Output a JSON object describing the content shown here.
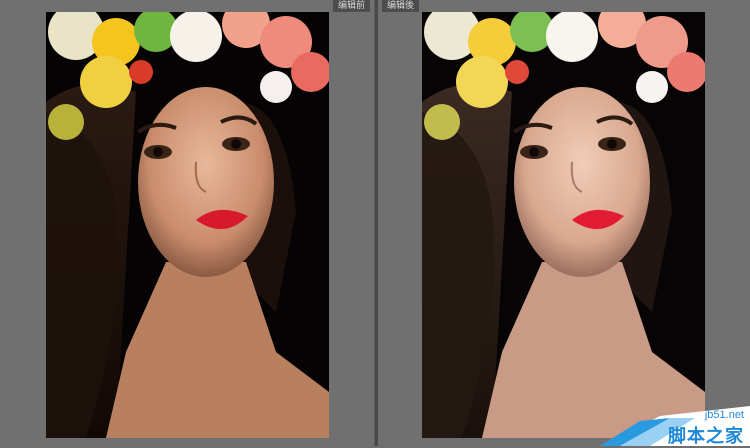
{
  "panels": {
    "before": {
      "label": "编辑前"
    },
    "after": {
      "label": "编辑後"
    }
  },
  "watermark": {
    "url": "jb51.net",
    "name": "脚本之家"
  },
  "colors": {
    "background": "#707070",
    "tag_bg": "#4d4d4d",
    "accent": "#1e88d8"
  }
}
